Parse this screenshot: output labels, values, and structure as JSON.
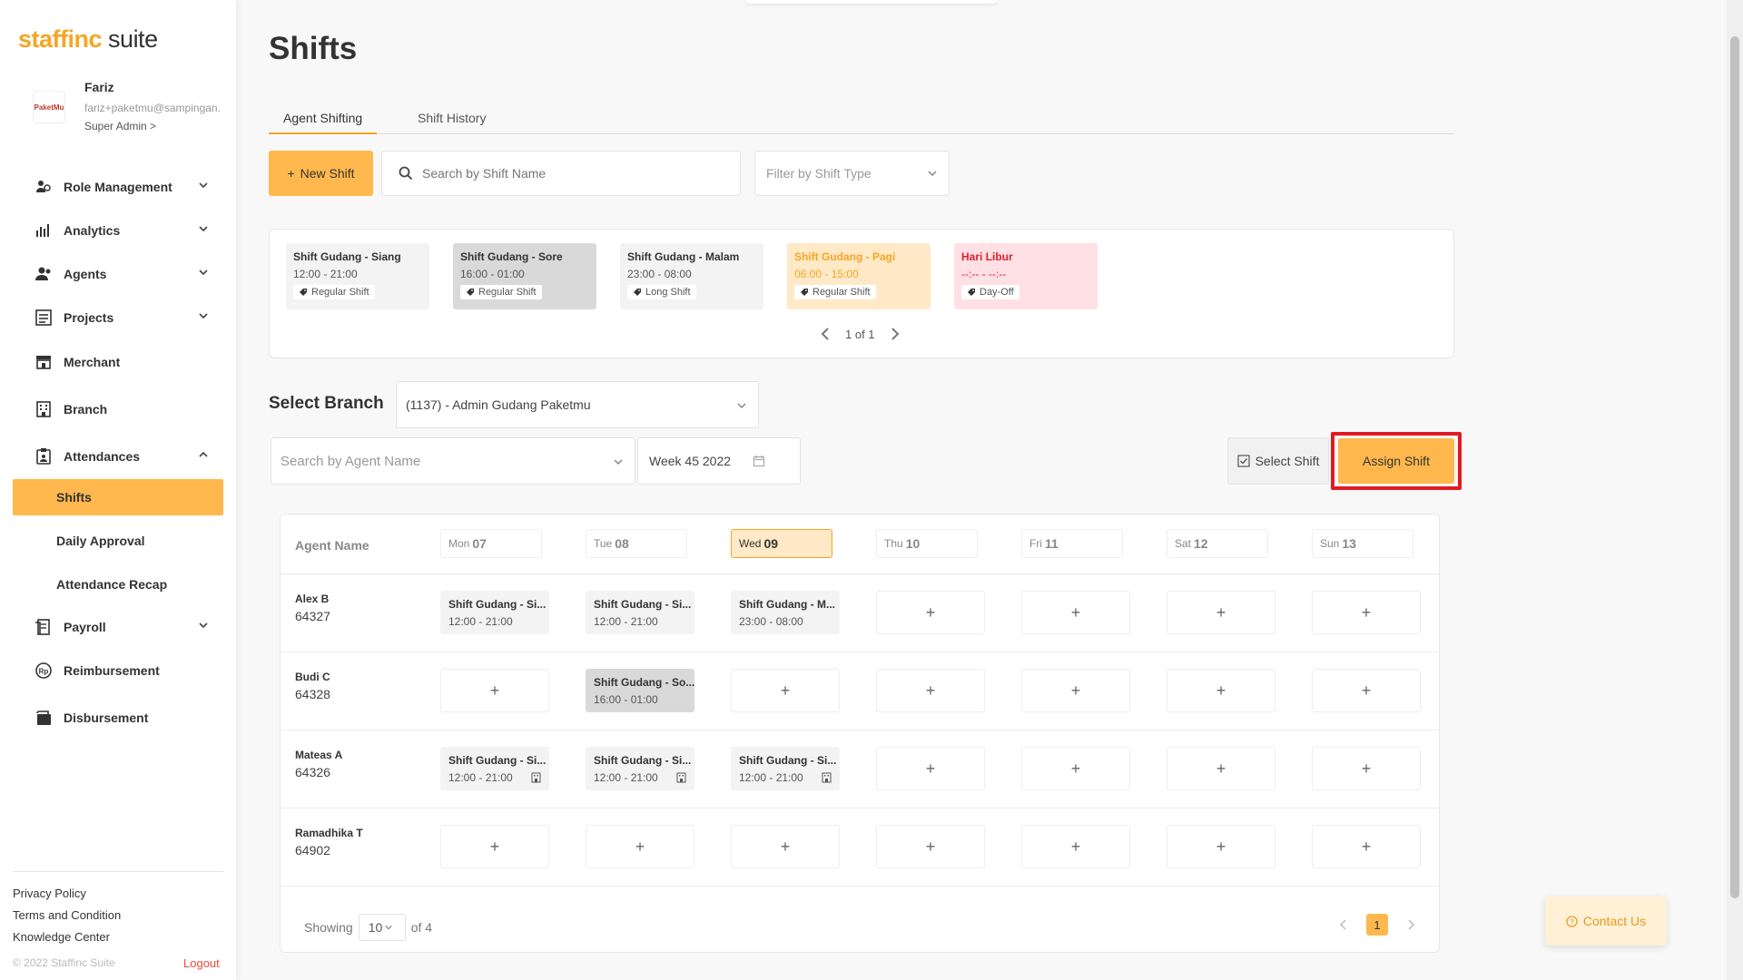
{
  "app": {
    "logo_brand": "staffinc",
    "logo_suffix": "suite"
  },
  "profile": {
    "avatar_text": "PaketMu",
    "name": "Fariz",
    "email": "fariz+paketmu@sampingan.",
    "role": "Super Admin >"
  },
  "sidebar": {
    "items": [
      {
        "label": "Role Management",
        "icon": "role-icon"
      },
      {
        "label": "Analytics",
        "icon": "analytics-icon"
      },
      {
        "label": "Agents",
        "icon": "agents-icon"
      },
      {
        "label": "Projects",
        "icon": "projects-icon"
      },
      {
        "label": "Merchant",
        "icon": "merchant-icon"
      },
      {
        "label": "Branch",
        "icon": "branch-icon"
      },
      {
        "label": "Attendances",
        "icon": "attendances-icon"
      },
      {
        "label": "Payroll",
        "icon": "payroll-icon"
      },
      {
        "label": "Reimbursement",
        "icon": "reimbursement-icon"
      },
      {
        "label": "Disbursement",
        "icon": "disbursement-icon"
      }
    ],
    "sub_items": [
      {
        "label": "Shifts",
        "active": true
      },
      {
        "label": "Daily Approval",
        "active": false
      },
      {
        "label": "Attendance Recap",
        "active": false
      }
    ],
    "footer_links": [
      "Privacy Policy",
      "Terms and Condition",
      "Knowledge Center"
    ],
    "copyright": "© 2022 Staffinc Suite",
    "logout": "Logout"
  },
  "page": {
    "title": "Shifts",
    "tabs": [
      {
        "label": "Agent Shifting",
        "active": true
      },
      {
        "label": "Shift History",
        "active": false
      }
    ]
  },
  "toolbar": {
    "new_shift": "New Shift",
    "search_placeholder": "Search by Shift Name",
    "filter_placeholder": "Filter by Shift Type"
  },
  "shift_types": [
    {
      "name": "Shift Gudang - Siang",
      "time": "12:00 - 21:00",
      "tag": "Regular Shift",
      "style": "default"
    },
    {
      "name": "Shift Gudang - Sore",
      "time": "16:00 - 01:00",
      "tag": "Regular Shift",
      "style": "sore"
    },
    {
      "name": "Shift Gudang - Malam",
      "time": "23:00 - 08:00",
      "tag": "Long Shift",
      "style": "default"
    },
    {
      "name": "Shift Gudang - Pagi",
      "time": "06:00 - 15:00",
      "tag": "Regular Shift",
      "style": "pagi"
    },
    {
      "name": "Hari Libur",
      "time": "--:-- - --:--",
      "tag": "Day-Off",
      "style": "libur"
    }
  ],
  "shift_pager": "1 of 1",
  "branch": {
    "label": "Select Branch",
    "value": "(1137) - Admin Gudang Paketmu"
  },
  "schedule_toolbar": {
    "agent_search_placeholder": "Search by Agent Name",
    "week": "Week 45 2022",
    "select_shift": "Select Shift",
    "assign_shift": "Assign Shift"
  },
  "grid": {
    "agent_col_title": "Agent Name",
    "days": [
      {
        "dow": "Mon",
        "date": "07",
        "today": false
      },
      {
        "dow": "Tue",
        "date": "08",
        "today": false
      },
      {
        "dow": "Wed",
        "date": "09",
        "today": true
      },
      {
        "dow": "Thu",
        "date": "10",
        "today": false
      },
      {
        "dow": "Fri",
        "date": "11",
        "today": false
      },
      {
        "dow": "Sat",
        "date": "12",
        "today": false
      },
      {
        "dow": "Sun",
        "date": "13",
        "today": false
      }
    ],
    "rows": [
      {
        "name": "Alex B",
        "id": "64327",
        "cells": [
          {
            "title": "Shift Gudang - Si...",
            "time": "12:00 - 21:00",
            "style": "default",
            "branch_icon": false
          },
          {
            "title": "Shift Gudang - Si...",
            "time": "12:00 - 21:00",
            "style": "default",
            "branch_icon": false
          },
          {
            "title": "Shift Gudang - M...",
            "time": "23:00 - 08:00",
            "style": "default",
            "branch_icon": false
          },
          null,
          null,
          null,
          null
        ]
      },
      {
        "name": "Budi C",
        "id": "64328",
        "cells": [
          null,
          {
            "title": "Shift Gudang - So...",
            "time": "16:00 - 01:00",
            "style": "sore",
            "branch_icon": false
          },
          null,
          null,
          null,
          null,
          null
        ]
      },
      {
        "name": "Mateas A",
        "id": "64326",
        "cells": [
          {
            "title": "Shift Gudang - Si...",
            "time": "12:00 - 21:00",
            "style": "default",
            "branch_icon": true
          },
          {
            "title": "Shift Gudang - Si...",
            "time": "12:00 - 21:00",
            "style": "default",
            "branch_icon": true
          },
          {
            "title": "Shift Gudang - Si...",
            "time": "12:00 - 21:00",
            "style": "default",
            "branch_icon": true
          },
          null,
          null,
          null,
          null
        ]
      },
      {
        "name": "Ramadhika T",
        "id": "64902",
        "cells": [
          null,
          null,
          null,
          null,
          null,
          null,
          null
        ]
      }
    ],
    "add_symbol": "+"
  },
  "footer": {
    "showing": "Showing",
    "per_page": "10",
    "of_total": "of 4",
    "current_page": "1"
  },
  "contact": "Contact Us",
  "colors": {
    "accent": "#ffb84d",
    "highlight_border": "#e01b22",
    "danger": "#e74c3c"
  }
}
